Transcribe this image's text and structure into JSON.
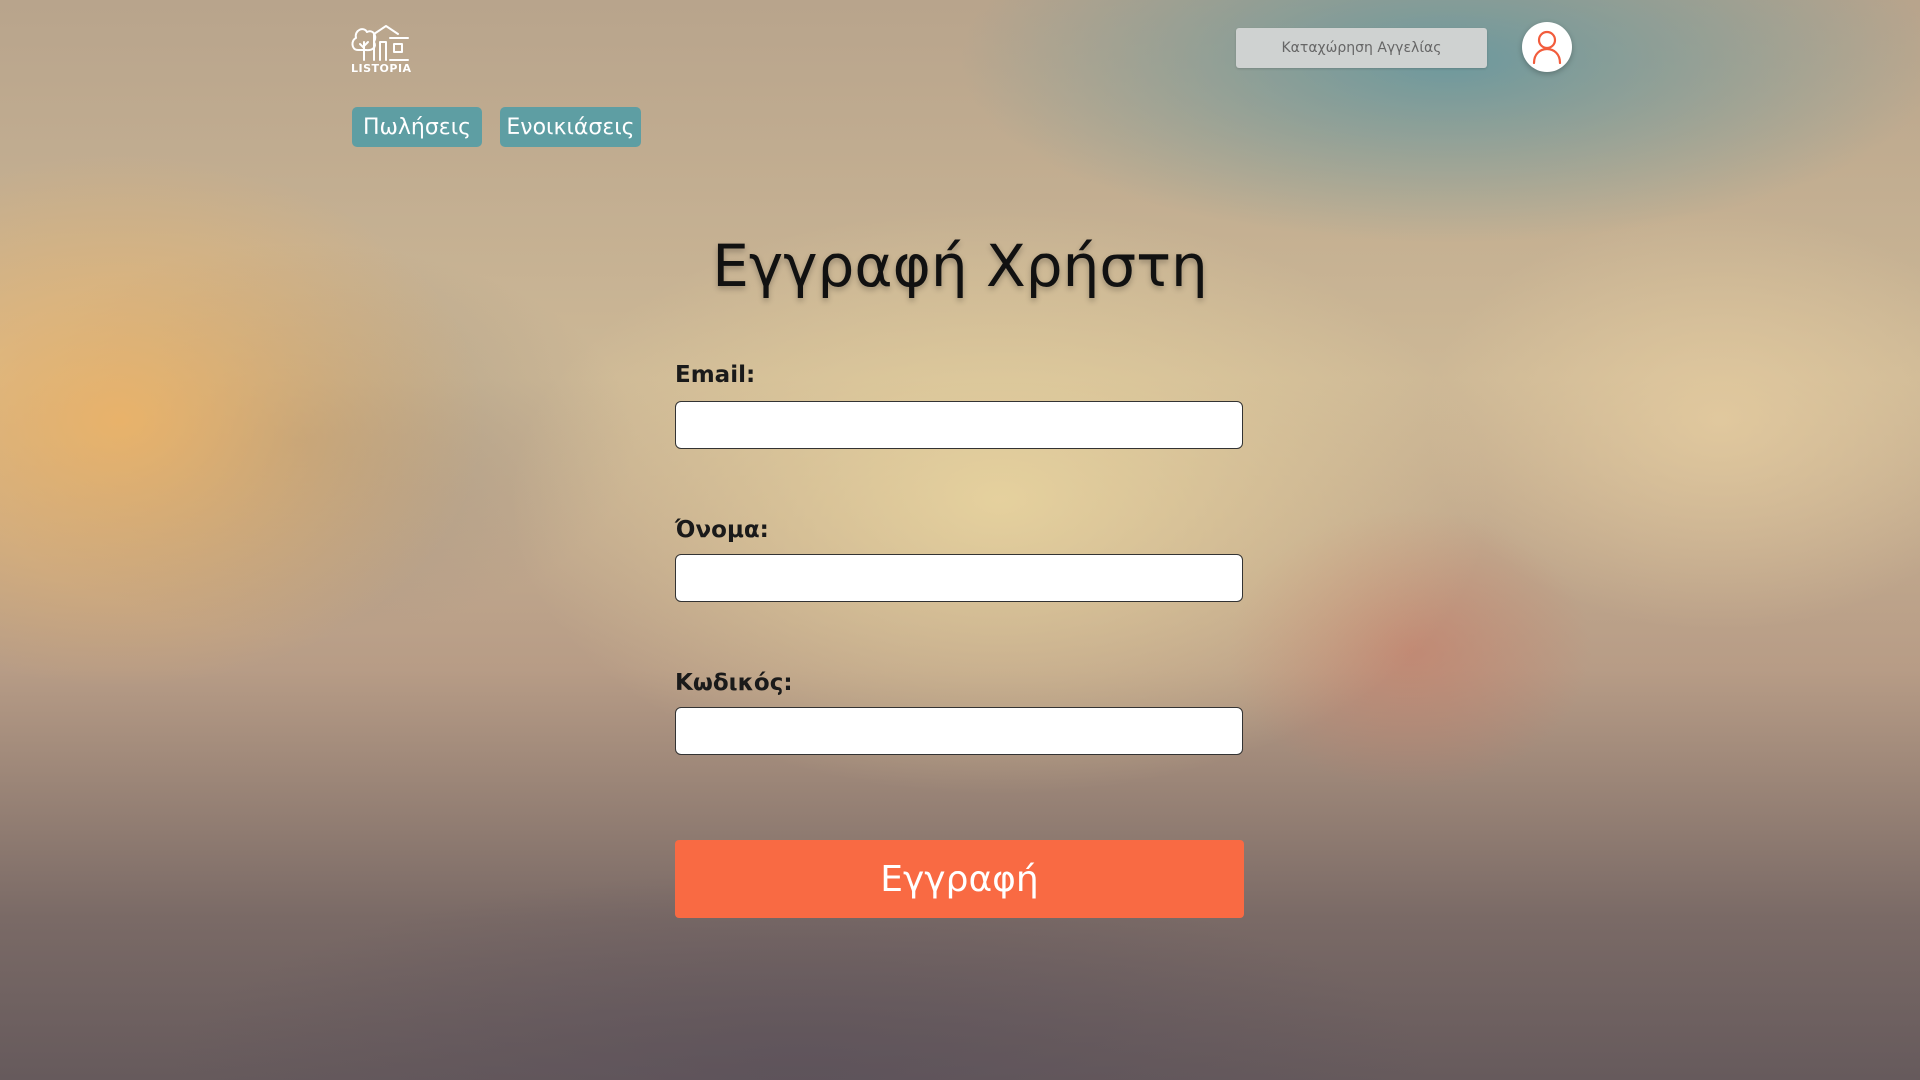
{
  "header": {
    "logo_text": "LISTOPIA",
    "post_ad_label": "Καταχώρηση Αγγελίας",
    "user_icon": "user-icon"
  },
  "nav": {
    "tabs": [
      {
        "label": "Πωλήσεις"
      },
      {
        "label": "Ενοικιάσεις"
      }
    ],
    "tab_color": "#5e9ea3"
  },
  "form": {
    "title": "Εγγραφή Χρήστη",
    "fields": [
      {
        "label": "Email:",
        "value": ""
      },
      {
        "label": "Όνομα:",
        "value": ""
      },
      {
        "label": "Κωδικός:",
        "value": ""
      }
    ],
    "submit_label": "Εγγραφή",
    "submit_color": "#f96a43"
  }
}
